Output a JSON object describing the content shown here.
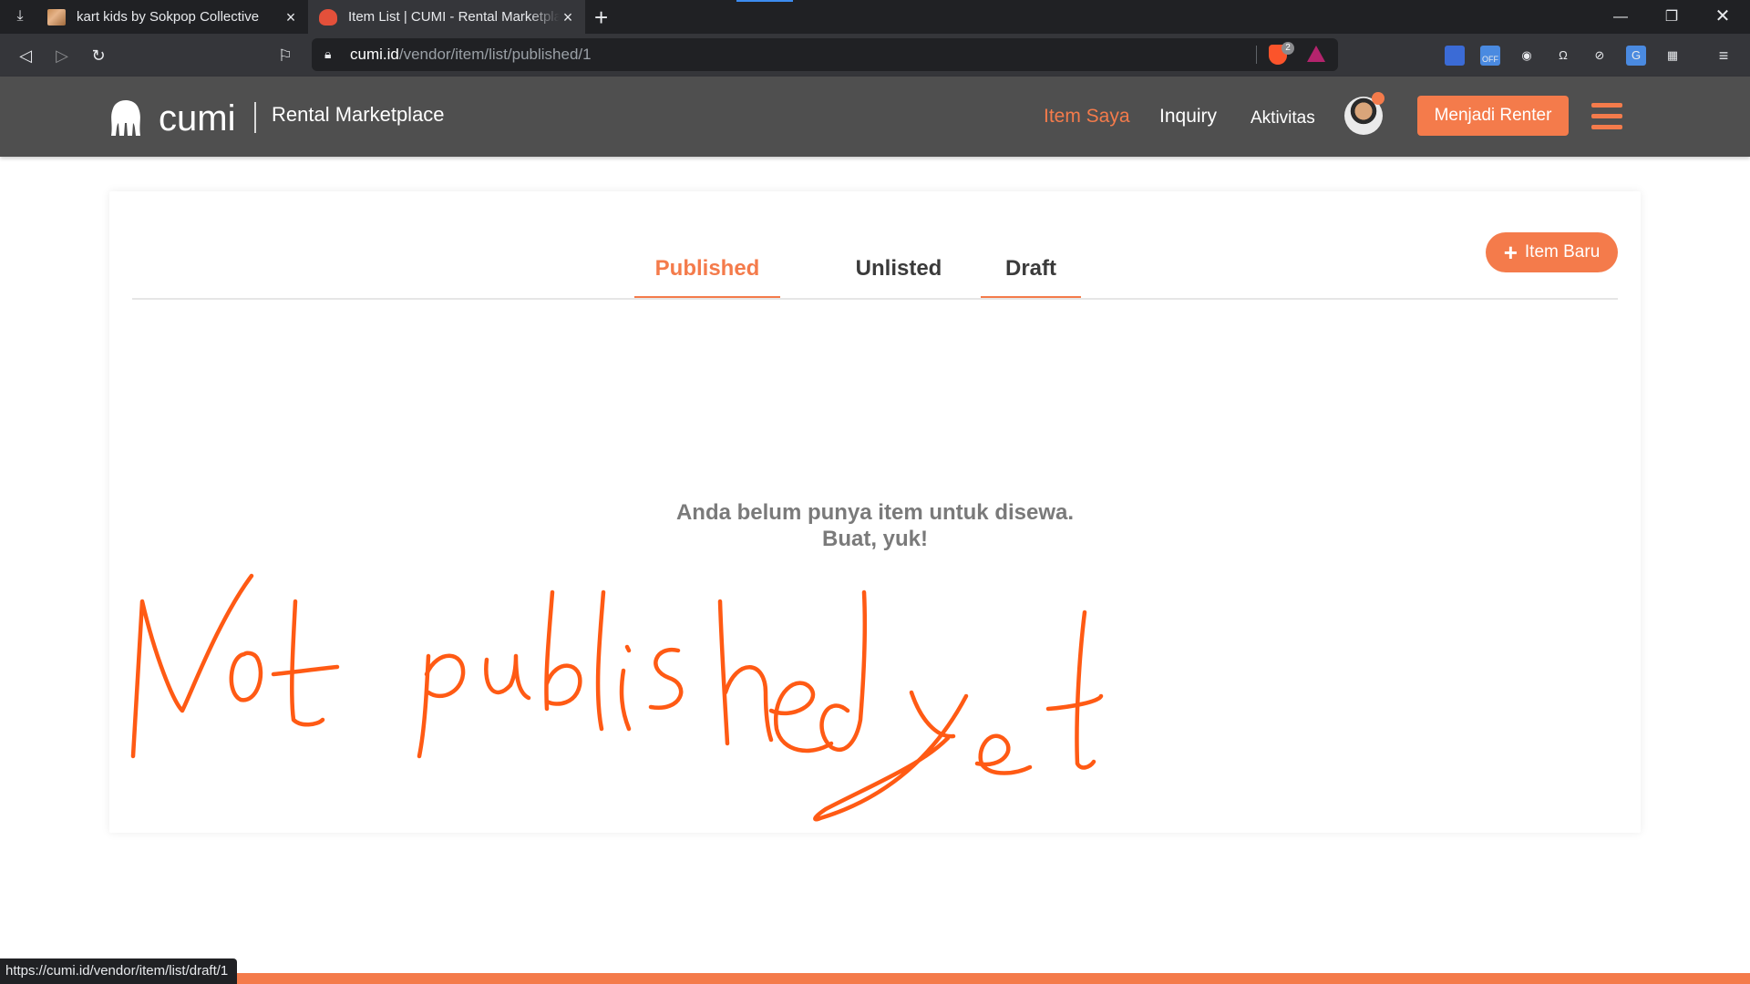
{
  "browser": {
    "tabs": [
      {
        "title": "kart kids by Sokpop Collective",
        "active": false
      },
      {
        "title": "Item List | CUMI - Rental Marketplace",
        "active": true
      }
    ],
    "url_domain": "cumi.id",
    "url_path": "/vendor/item/list/published/1",
    "shield_count": "2",
    "status_url": "https://cumi.id/vendor/item/list/draft/1"
  },
  "header": {
    "logo_text": "cumi",
    "subtitle": "Rental Marketplace",
    "nav": [
      {
        "label": "Item Saya",
        "active": true
      },
      {
        "label": "Inquiry",
        "active": false
      },
      {
        "label": "Aktivitas",
        "active": false
      }
    ],
    "cta_label": "Menjadi Renter"
  },
  "content": {
    "tabs": [
      {
        "label": "Published",
        "active": true
      },
      {
        "label": "Unlisted",
        "active": false
      },
      {
        "label": "Draft",
        "active": false
      }
    ],
    "new_item_label": "Item Baru",
    "empty_line1": "Anda belum punya item untuk disewa.",
    "empty_line2": "Buat, yuk!"
  },
  "annotation": {
    "text": "Not published yet",
    "color": "#ff5a14"
  },
  "colors": {
    "accent": "#f47b4b",
    "header_bg": "#4f4f4f",
    "chrome_dark": "#202124"
  }
}
